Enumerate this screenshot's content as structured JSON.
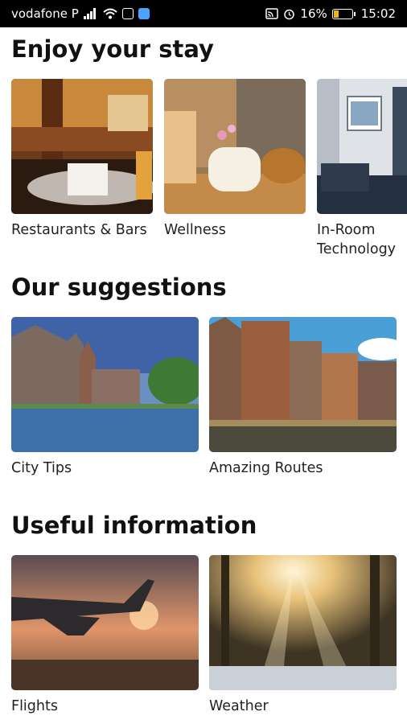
{
  "status_bar": {
    "carrier": "vodafone P",
    "battery_percent": "16%",
    "time": "15:02",
    "icons": [
      "signal-icon",
      "wifi-icon",
      "notification-icon",
      "app-icon",
      "cast-icon",
      "alarm-icon",
      "battery-icon"
    ]
  },
  "sections": [
    {
      "title": "Enjoy your stay",
      "cards": [
        {
          "label": "Restaurants & Bars"
        },
        {
          "label": "Wellness"
        },
        {
          "label_lines": [
            "In-Room",
            "Technology"
          ]
        }
      ]
    },
    {
      "title": "Our suggestions",
      "cards": [
        {
          "label": "City Tips"
        },
        {
          "label": "Amazing Routes"
        }
      ]
    },
    {
      "title": "Useful information",
      "cards": [
        {
          "label": "Flights"
        },
        {
          "label": "Weather"
        }
      ]
    }
  ]
}
